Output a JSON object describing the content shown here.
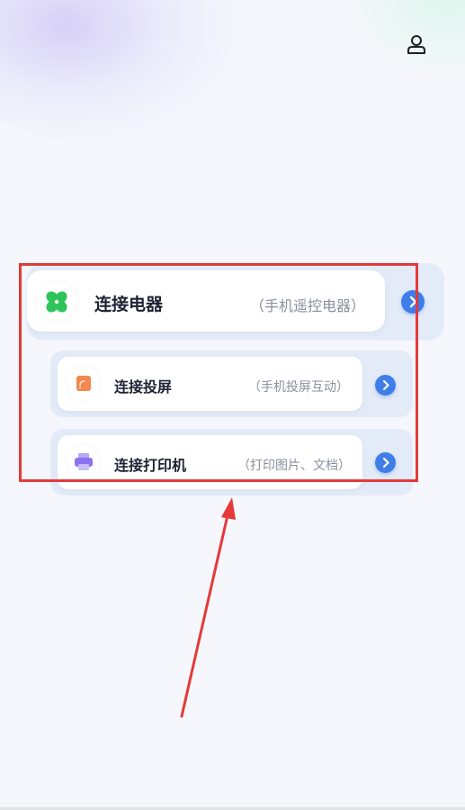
{
  "header": {
    "user_icon": "user-icon"
  },
  "menu": {
    "connect_appliance": {
      "title": "连接电器",
      "subtitle": "（手机遥控电器）",
      "icon": "fan-icon",
      "icon_color": "#2fc45a"
    },
    "connect_screen": {
      "title": "连接投屏",
      "subtitle": "（手机投屏互动）",
      "icon": "screen-cast-icon",
      "icon_color": "#f2874f"
    },
    "connect_printer": {
      "title": "连接打印机",
      "subtitle": "（打印图片、文档）",
      "icon": "printer-icon",
      "icon_color": "#8b72ee"
    }
  },
  "colors": {
    "accent": "#3f7ee8",
    "annotation": "#e43a3a",
    "card_bg": "#e4ebf8"
  }
}
